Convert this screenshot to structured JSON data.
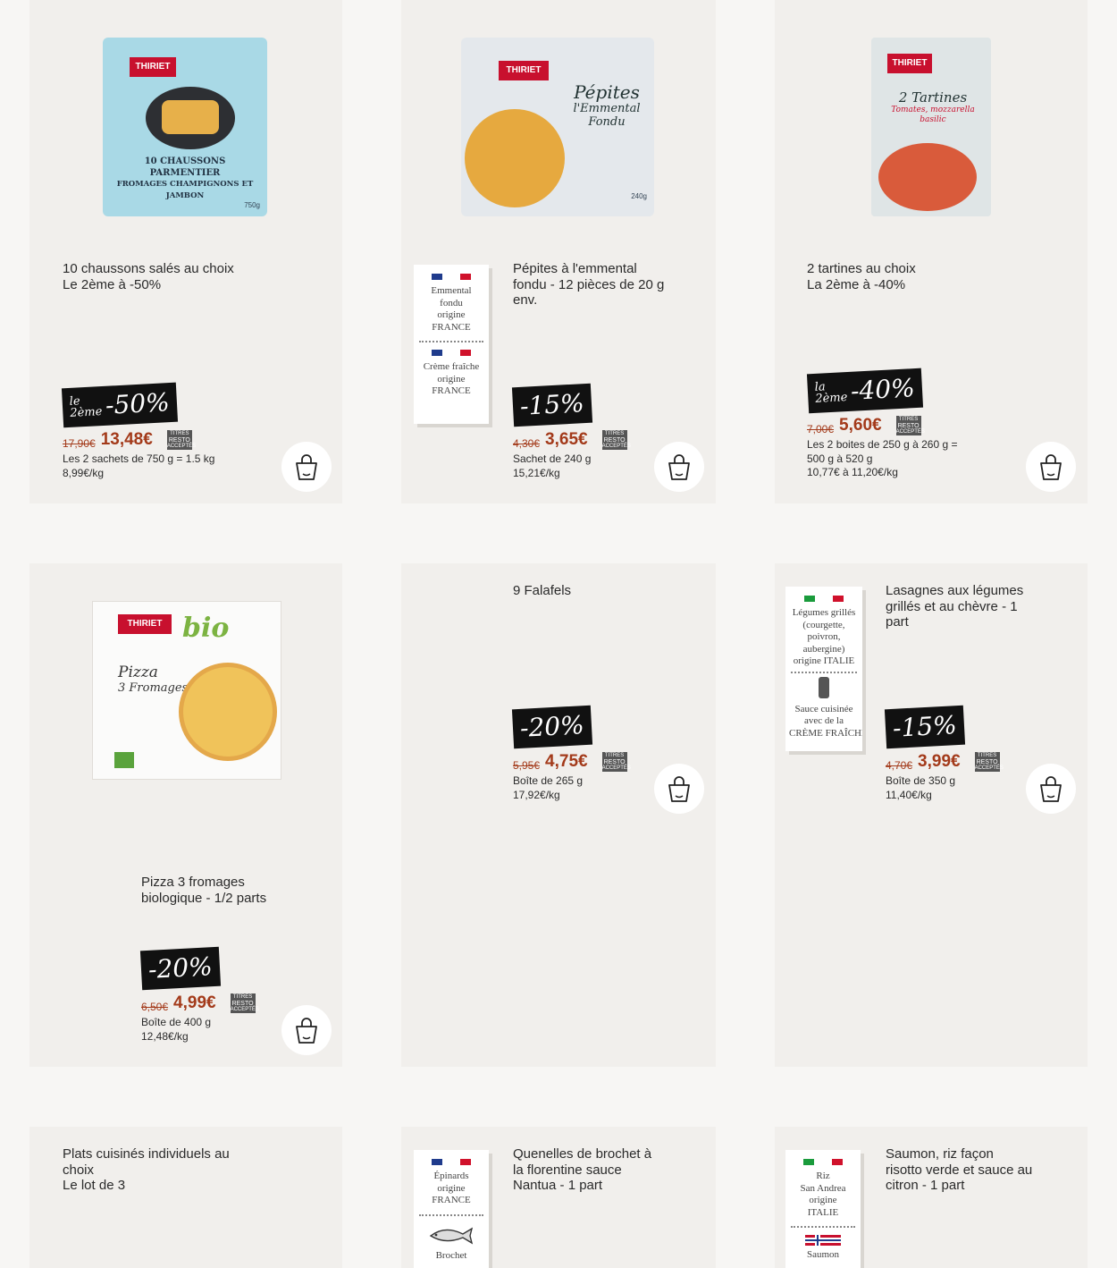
{
  "cards": [
    {
      "title": [
        "10 chaussons salés au choix",
        "Le 2ème à -50%"
      ],
      "badge_small": [
        "le",
        "2ème"
      ],
      "badge_big": "-50%",
      "old_price": "17,90€",
      "price": "13,48€",
      "resto": [
        "TITRES",
        "RESTO",
        "ACCEPTÉS"
      ],
      "pack": [
        "Les 2 sachets de 750 g = 1.5 kg",
        "8,99€/kg"
      ],
      "product_text": [
        "10 CHAUSSONS PARMENTIER",
        "FROMAGES CHAMPIGNONS ET JAMBON"
      ],
      "brand": "THIRIET",
      "weight": "750g"
    },
    {
      "title": [
        "Pépites à l'emmental",
        "fondu - 12 pièces de 20 g",
        "env."
      ],
      "badge_big": "-15%",
      "old_price": "4,30€",
      "price": "3,65€",
      "resto": [
        "TITRES",
        "RESTO",
        "ACCEPTÉS"
      ],
      "pack": [
        "Sachet de 240 g",
        "15,21€/kg"
      ],
      "origin": [
        "Emmental",
        "fondu",
        "origine",
        "FRANCE"
      ],
      "origin2": [
        "Crème fraîche",
        "origine",
        "FRANCE"
      ],
      "product_text": [
        "Pépites",
        "l'Emmental",
        "Fondu"
      ],
      "brand": "THIRIET",
      "weight": "240g"
    },
    {
      "title": [
        "2 tartines au choix",
        "La 2ème à -40%"
      ],
      "badge_small": [
        "la",
        "2ème"
      ],
      "badge_big": "-40%",
      "old_price": "7,00€",
      "price": "5,60€",
      "resto": [
        "TITRES",
        "RESTO",
        "ACCEPTÉS"
      ],
      "pack": [
        "Les 2 boites de 250 g à 260 g =",
        "500 g à 520 g",
        "10,77€ à 11,20€/kg"
      ],
      "product_text": [
        "2 Tartines",
        "Tomates, mozzarella",
        "basilic"
      ],
      "brand": "THIRIET"
    },
    {
      "title": [
        "Pizza 3 fromages",
        "biologique - 1/2 parts"
      ],
      "badge_big": "-20%",
      "old_price": "6,50€",
      "price": "4,99€",
      "resto": [
        "TITRES",
        "RESTO",
        "ACCEPTÉS"
      ],
      "pack": [
        "Boîte de 400 g",
        "12,48€/kg"
      ],
      "product_text": [
        "bio",
        "Pizza",
        "3 Fromages"
      ],
      "brand": "THIRIET"
    },
    {
      "title": [
        "9 Falafels"
      ],
      "badge_big": "-20%",
      "old_price": "5,95€",
      "price": "4,75€",
      "resto": [
        "TITRES",
        "RESTO",
        "ACCEPTÉS"
      ],
      "pack": [
        "Boîte de 265 g",
        "17,92€/kg"
      ]
    },
    {
      "title": [
        "Lasagnes aux légumes",
        "grillés et au chèvre - 1",
        "part"
      ],
      "badge_big": "-15%",
      "old_price": "4,70€",
      "price": "3,99€",
      "resto": [
        "TITRES",
        "RESTO",
        "ACCEPTÉS"
      ],
      "pack": [
        "Boîte de 350 g",
        "11,40€/kg"
      ],
      "origin": [
        "Légumes grillés",
        "(courgette,",
        "poivron,",
        "aubergine)",
        "origine ITALIE"
      ],
      "origin2": [
        "Sauce cuisinée",
        "avec de la",
        "CRÈME FRAÎCHE"
      ]
    },
    {
      "title": [
        "Plats cuisinés individuels au",
        "choix",
        "Le lot de 3"
      ]
    },
    {
      "title": [
        "Quenelles de brochet à",
        "la florentine sauce",
        "Nantua - 1 part"
      ],
      "origin": [
        "Épinards",
        "origine",
        "FRANCE"
      ],
      "origin2": [
        "Brochet"
      ]
    },
    {
      "title": [
        "Saumon, riz façon",
        "risotto verde et sauce au",
        "citron - 1 part"
      ],
      "origin": [
        "Riz",
        "San Andrea",
        "origine",
        "ITALIE"
      ],
      "origin2": [
        "Saumon"
      ]
    }
  ],
  "colors": {
    "price": "#a33a1a",
    "card_bg": "#f1efec",
    "page_bg": "#f7f6f4",
    "badge": "#111111",
    "pack_blue": "#9fd3e3"
  },
  "icons": [
    "basket-icon",
    "flag-france-icon",
    "flag-italy-icon",
    "flag-norway-icon",
    "fish-icon",
    "bottle-icon"
  ]
}
